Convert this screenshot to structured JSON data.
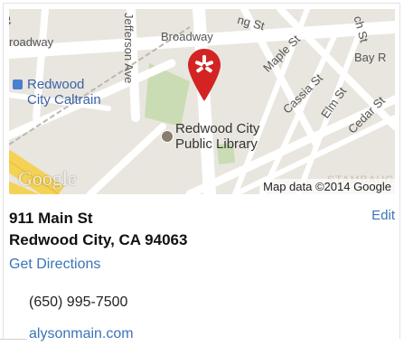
{
  "map": {
    "street_labels": [
      "St",
      "roadway",
      "Broadway",
      "Jefferson Ave",
      "ng St",
      "Maple St",
      "Cassia St",
      "Elm St",
      "Cedar St",
      "Bay R",
      "ch St"
    ],
    "poi_caltrain": "Redwood\nCity Caltrain",
    "poi_library": "Redwood City\nPublic Library",
    "attribution": "Map data ©2014 Google",
    "google_logo": "Google",
    "marker_color": "#d32323",
    "bottom_street_label": "STAMBAUG"
  },
  "info": {
    "address_line1": "911 Main St",
    "address_line2": "Redwood City, CA 94063",
    "edit_label": "Edit",
    "directions_label": "Get Directions",
    "phone": "(650) 995-7500",
    "website": "alysonmain.com"
  },
  "colors": {
    "link": "#3b73b9",
    "map_bg": "#e9e6df"
  }
}
